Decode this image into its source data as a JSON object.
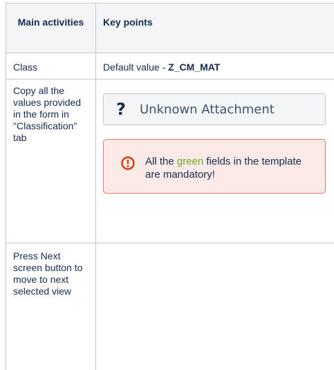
{
  "table": {
    "headers": {
      "main": "Main activities",
      "key": "Key points"
    },
    "rows": {
      "class_row": {
        "activity": "Class",
        "key_prefix": "Default value - ",
        "key_value": "Z_CM_MAT"
      },
      "copy_row": {
        "activity": "Copy all the values provided in the form in \"Classification\" tab",
        "attachment": {
          "icon": "question-mark-icon",
          "label": "Unknown Attachment"
        },
        "warning": {
          "icon": "exclamation-circle-icon",
          "text_before": "All the ",
          "text_green": "green",
          "text_after": " fields in the template are mandatory!"
        }
      },
      "next_row": {
        "activity": "Press Next screen button to move to next selected view"
      }
    }
  },
  "colors": {
    "border": "#c1c7d0",
    "header_bg": "#f4f5f7",
    "warning_border": "#e57373",
    "warning_bg": "#fbeae8",
    "warning_icon": "#de350b",
    "green_text": "#6aab1d"
  }
}
